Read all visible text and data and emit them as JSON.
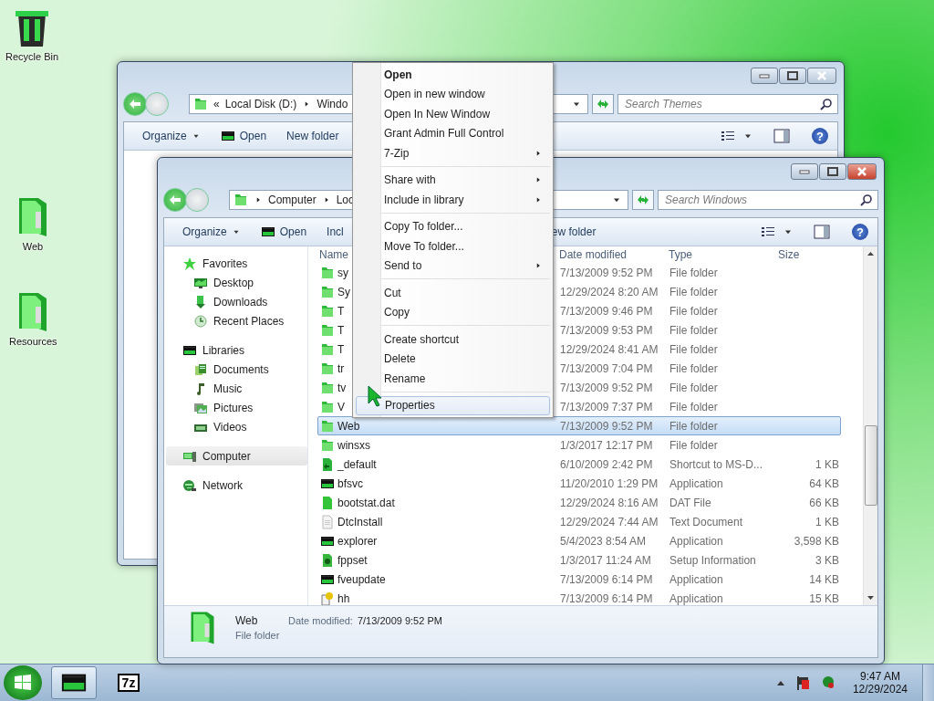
{
  "desktop_icons": [
    {
      "label": "Recycle Bin",
      "kind": "trash"
    },
    {
      "label": "Web",
      "kind": "bigfolder"
    },
    {
      "label": "Resources",
      "kind": "bigfolder"
    }
  ],
  "back_window": {
    "active": false,
    "address": {
      "overflow_glyph": "«",
      "segments": [
        "Local Disk (D:)",
        "Windo"
      ]
    },
    "search": {
      "placeholder": "Search Themes"
    },
    "help_glyph": "?",
    "toolbar": [
      {
        "label": "Organize",
        "kind": "menu"
      },
      {
        "label": "Open",
        "kind": "open"
      },
      {
        "label": "New folder",
        "kind": "plain"
      }
    ]
  },
  "front_window": {
    "active": true,
    "address": {
      "segments": [
        "Computer",
        "Loc"
      ]
    },
    "search": {
      "placeholder": "Search Windows"
    },
    "help_glyph": "?",
    "toolbar": [
      {
        "label": "Organize",
        "kind": "menu"
      },
      {
        "label": "Open",
        "kind": "open"
      },
      {
        "label": "Incl",
        "kind": "plain"
      },
      {
        "label": "ew folder",
        "kind": "plain"
      }
    ],
    "nav": [
      {
        "label": "Favorites",
        "kind": "star",
        "selected": false,
        "children": [
          {
            "label": "Desktop",
            "kind": "desktop",
            "selected": false
          },
          {
            "label": "Downloads",
            "kind": "download",
            "selected": false
          },
          {
            "label": "Recent Places",
            "kind": "recent",
            "selected": false
          }
        ]
      },
      {
        "label": "Libraries",
        "kind": "app",
        "selected": false,
        "children": [
          {
            "label": "Documents",
            "kind": "documents",
            "selected": false
          },
          {
            "label": "Music",
            "kind": "music",
            "selected": false
          },
          {
            "label": "Pictures",
            "kind": "pictures",
            "selected": false
          },
          {
            "label": "Videos",
            "kind": "videos",
            "selected": false
          }
        ]
      },
      {
        "label": "Computer",
        "kind": "computer",
        "selected": true
      },
      {
        "label": "Network",
        "kind": "network",
        "selected": false
      }
    ],
    "columns": [
      "Name",
      "Date modified",
      "Type",
      "Size"
    ],
    "rows": [
      {
        "name": "sy",
        "date": "7/13/2009 9:52 PM",
        "type": "File folder",
        "kind": "folder",
        "selected": false
      },
      {
        "name": "Sy",
        "date": "12/29/2024 8:20 AM",
        "type": "File folder",
        "kind": "folder",
        "selected": false
      },
      {
        "name": "T",
        "date": "7/13/2009 9:46 PM",
        "type": "File folder",
        "kind": "folder",
        "selected": false
      },
      {
        "name": "T",
        "date": "7/13/2009 9:53 PM",
        "type": "File folder",
        "kind": "folder",
        "selected": false
      },
      {
        "name": "T",
        "date": "12/29/2024 8:41 AM",
        "type": "File folder",
        "kind": "folder",
        "selected": false
      },
      {
        "name": "tr",
        "date": "7/13/2009 7:04 PM",
        "type": "File folder",
        "kind": "folder",
        "selected": false
      },
      {
        "name": "tv",
        "date": "7/13/2009 9:52 PM",
        "type": "File folder",
        "kind": "folder",
        "selected": false
      },
      {
        "name": "V",
        "date": "7/13/2009 7:37 PM",
        "type": "File folder",
        "kind": "folder",
        "selected": false
      },
      {
        "name": "Web",
        "date": "7/13/2009 9:52 PM",
        "type": "File folder",
        "kind": "folder",
        "selected": true
      },
      {
        "name": "winsxs",
        "date": "1/3/2017 12:17 PM",
        "type": "File folder",
        "kind": "folder",
        "selected": false
      },
      {
        "name": "_default",
        "date": "6/10/2009 2:42 PM",
        "type": "Shortcut to MS-D...",
        "size": "1 KB",
        "kind": "shortcut",
        "selected": false
      },
      {
        "name": "bfsvc",
        "date": "11/20/2010 1:29 PM",
        "type": "Application",
        "size": "64 KB",
        "kind": "app",
        "selected": false
      },
      {
        "name": "bootstat.dat",
        "date": "12/29/2024 8:16 AM",
        "type": "DAT File",
        "size": "66 KB",
        "kind": "file",
        "selected": false
      },
      {
        "name": "DtcInstall",
        "date": "12/29/2024 7:44 AM",
        "type": "Text Document",
        "size": "1 KB",
        "kind": "text",
        "selected": false
      },
      {
        "name": "explorer",
        "date": "5/4/2023 8:54 AM",
        "type": "Application",
        "size": "3,598 KB",
        "kind": "app",
        "selected": false
      },
      {
        "name": "fppset",
        "date": "1/3/2017 11:24 AM",
        "type": "Setup Information",
        "size": "3 KB",
        "kind": "setup",
        "selected": false
      },
      {
        "name": "fveupdate",
        "date": "7/13/2009 6:14 PM",
        "type": "Application",
        "size": "14 KB",
        "kind": "app",
        "selected": false
      },
      {
        "name": "hh",
        "date": "7/13/2009 6:14 PM",
        "type": "Application",
        "size": "15 KB",
        "kind": "help",
        "selected": false
      }
    ],
    "details": {
      "name": "Web",
      "date_label": "Date modified:",
      "date": "7/13/2009 9:52 PM",
      "type": "File folder"
    }
  },
  "context_menu": {
    "groups": [
      [
        {
          "label": "Open",
          "bold": true,
          "submenu": false,
          "selected": false
        },
        {
          "label": "Open in new window",
          "bold": false,
          "submenu": false,
          "selected": false
        },
        {
          "label": "Open In New Window",
          "bold": false,
          "submenu": false,
          "selected": false
        },
        {
          "label": "Grant Admin Full Control",
          "bold": false,
          "submenu": false,
          "selected": false
        },
        {
          "label": "7-Zip",
          "bold": false,
          "submenu": true,
          "selected": false
        }
      ],
      [
        {
          "label": "Share with",
          "bold": false,
          "submenu": true,
          "selected": false
        },
        {
          "label": "Include in library",
          "bold": false,
          "submenu": true,
          "selected": false
        }
      ],
      [
        {
          "label": "Copy To folder...",
          "bold": false,
          "submenu": false,
          "selected": false
        },
        {
          "label": "Move To folder...",
          "bold": false,
          "submenu": false,
          "selected": false
        },
        {
          "label": "Send to",
          "bold": false,
          "submenu": true,
          "selected": false
        }
      ],
      [
        {
          "label": "Cut",
          "bold": false,
          "submenu": false,
          "selected": false
        },
        {
          "label": "Copy",
          "bold": false,
          "submenu": false,
          "selected": false
        }
      ],
      [
        {
          "label": "Create shortcut",
          "bold": false,
          "submenu": false,
          "selected": false
        },
        {
          "label": "Delete",
          "bold": false,
          "submenu": false,
          "selected": false
        },
        {
          "label": "Rename",
          "bold": false,
          "submenu": false,
          "selected": false
        }
      ],
      [
        {
          "label": "Properties",
          "bold": false,
          "submenu": false,
          "selected": true
        }
      ]
    ]
  },
  "taskbar": {
    "pinned": [
      {
        "kind": "app",
        "selected": true
      },
      {
        "kind": "sevenzip",
        "label": "7z",
        "selected": false
      }
    ],
    "clock_time": "9:47 AM",
    "clock_date": "12/29/2024"
  }
}
